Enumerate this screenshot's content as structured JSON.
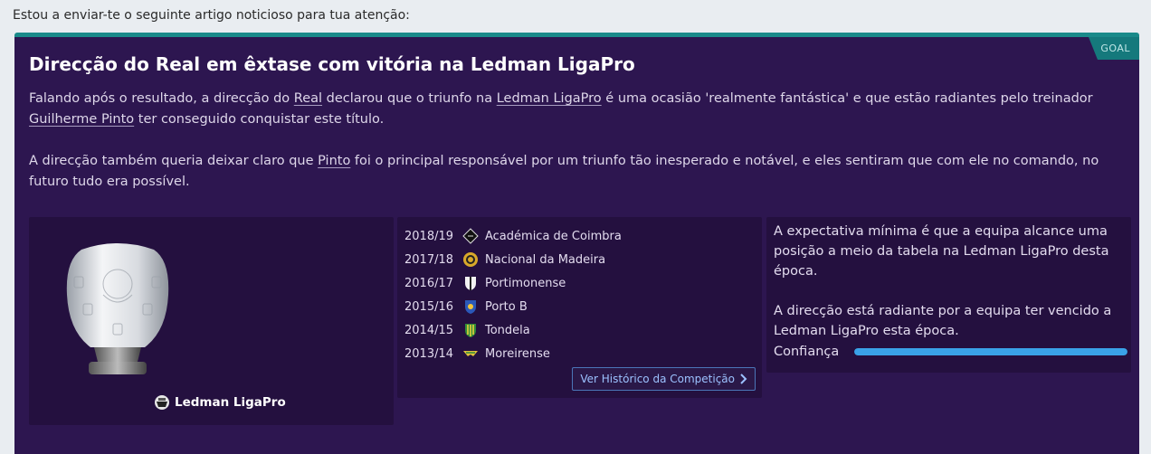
{
  "intro": "Estou a enviar-te o seguinte artigo noticioso para tua atenção:",
  "badge": "GOAL",
  "headline": "Direcção do Real em êxtase com vitória na Ledman LigaPro",
  "paragraph1": {
    "t1": "Falando após o resultado, a direcção do ",
    "club": "Real",
    "t2": " declarou que o triunfo na ",
    "league": "Ledman LigaPro",
    "t3": " é uma ocasião 'realmente fantástica' e que estão radiantes pelo treinador ",
    "coach": "Guilherme Pinto",
    "t4": " ter conseguido conquistar este título."
  },
  "paragraph2": {
    "t1": "A direcção também queria deixar claro que ",
    "coach": "Pinto",
    "t2": " foi o principal responsável por um triunfo tão inesperado e notável, e eles sentiram que com ele no comando, no futuro tudo era possível."
  },
  "competition": "Ledman LigaPro",
  "history": [
    {
      "season": "2018/19",
      "club": "Académica de Coimbra",
      "crest": "academica-crest"
    },
    {
      "season": "2017/18",
      "club": "Nacional da Madeira",
      "crest": "nacional-crest"
    },
    {
      "season": "2016/17",
      "club": "Portimonense",
      "crest": "portimonense-crest"
    },
    {
      "season": "2015/16",
      "club": "Porto B",
      "crest": "porto-crest"
    },
    {
      "season": "2014/15",
      "club": "Tondela",
      "crest": "tondela-crest"
    },
    {
      "season": "2013/14",
      "club": "Moreirense",
      "crest": "moreirense-crest"
    }
  ],
  "history_button": "Ver Histórico da Competição",
  "expectation1": "A expectativa mínima é que a equipa alcance uma posição a meio da tabela na Ledman LigaPro desta época.",
  "expectation2": "A direcção está radiante por a equipa ter vencido a Ledman LigaPro esta época.",
  "confidence_label": "Confiança",
  "confidence_level": 1.0,
  "colors": {
    "card_bg": "#2d1650",
    "panel_bg": "#24103f",
    "accent_teal": "#15797c",
    "confidence_bar": "#3aa2e8",
    "button_border": "#4b76b8"
  }
}
